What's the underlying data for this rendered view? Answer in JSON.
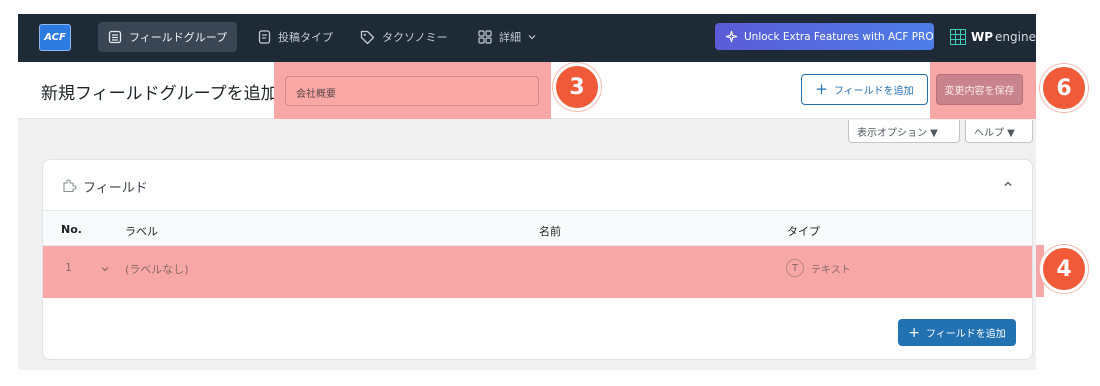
{
  "nav": {
    "logo": "ACF",
    "tabs": [
      {
        "label": "フィールドグループ",
        "icon": "list-icon",
        "active": true
      },
      {
        "label": "投稿タイプ",
        "icon": "document-icon",
        "active": false
      },
      {
        "label": "タクソノミー",
        "icon": "tag-icon",
        "active": false
      },
      {
        "label": "詳細",
        "icon": "grid-icon",
        "active": false
      }
    ],
    "promo_label": "Unlock Extra Features with ACF PRO",
    "brand_wp": "WP",
    "brand_engine": "engine"
  },
  "header": {
    "title": "新規フィールドグループを追加",
    "title_input_value": "会社概要",
    "add_field_label": "フィールドを追加",
    "save_label": "変更内容を保存"
  },
  "screen_meta": {
    "display_options": "表示オプション ▼",
    "help": "ヘルプ ▼"
  },
  "fields_panel": {
    "title": "フィールド",
    "columns": {
      "no": "No.",
      "label": "ラベル",
      "name": "名前",
      "type": "タイプ"
    },
    "rows": [
      {
        "no": "1",
        "label": "(ラベルなし)",
        "name": "",
        "type": "テキスト",
        "type_icon_glyph": "T"
      }
    ],
    "add_field_label": "フィールドを追加"
  },
  "badges": [
    "3",
    "4",
    "6"
  ],
  "colors": {
    "nav_bg": "#1f2a37",
    "primary": "#2271b1",
    "highlight": "#f7a7a5",
    "badge": "#f05a38",
    "save_button": "#c9838c"
  }
}
